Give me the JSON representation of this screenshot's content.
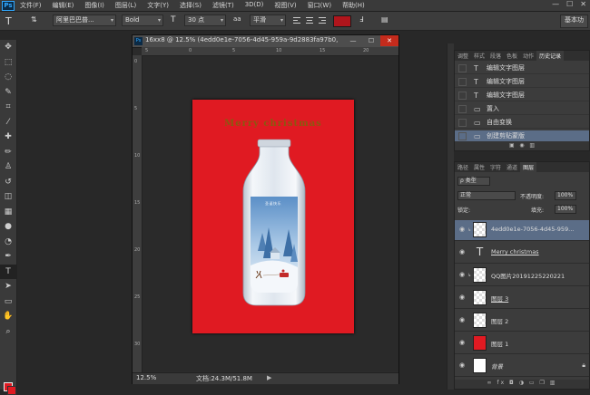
{
  "app": {
    "logo": "Ps"
  },
  "menu": [
    "文件(F)",
    "编辑(E)",
    "图像(I)",
    "图层(L)",
    "文字(Y)",
    "选择(S)",
    "滤镜(T)",
    "3D(D)",
    "视图(V)",
    "窗口(W)",
    "帮助(H)"
  ],
  "window_controls": {
    "minimize": "—",
    "maximize": "☐",
    "close": "✕"
  },
  "options": {
    "tool_icon": "T",
    "font_family": "阿里巴巴普...",
    "font_style": "Bold",
    "size_icon": "T",
    "font_size": "30 点",
    "aa_icon": "aa",
    "antialias": "平滑",
    "text_color": "#b0151c",
    "workspace": "基本功"
  },
  "document": {
    "title": "16xx8 @ 12.5% (4edd0e1e-7056-4d45-959a-9d2883fa97b0, R...",
    "zoom": "12.5%",
    "info": "文档:24.3M/51.8M",
    "artboard_text": "Merry christmas",
    "bottle_label": "圣诞快乐",
    "ruler_top": [
      "5",
      "0",
      "5",
      "10",
      "15",
      "20"
    ],
    "ruler_left": [
      "0",
      "5",
      "10",
      "15",
      "20",
      "25",
      "30"
    ],
    "artboard_color": "#e01a22"
  },
  "history": {
    "tabs": [
      "调整",
      "样式",
      "段落",
      "色板",
      "动作",
      "历史记录"
    ],
    "active_tab": 5,
    "rows": [
      {
        "icon": "T",
        "label": "编辑文字图层"
      },
      {
        "icon": "T",
        "label": "编辑文字图层"
      },
      {
        "icon": "T",
        "label": "编辑文字图层"
      },
      {
        "icon": "▭",
        "label": "置入"
      },
      {
        "icon": "▭",
        "label": "自由变换"
      },
      {
        "icon": "▭",
        "label": "创建剪贴蒙版"
      }
    ],
    "selected_row": 5
  },
  "layers": {
    "tabs": [
      "路径",
      "属性",
      "字符",
      "通道",
      "图层"
    ],
    "active_tab": 4,
    "filter_kind": "ρ 类型",
    "blend_mode": "正常",
    "opacity_label": "不透明度:",
    "opacity": "100%",
    "lock_label": "锁定:",
    "fill_label": "填充:",
    "fill": "100%",
    "items": [
      {
        "name": "4edd0e1e-7056-4d45-959...",
        "thumb": "checker",
        "clip": true,
        "selected": true,
        "style": ""
      },
      {
        "name": "Merry christmas",
        "thumb": "text",
        "clip": false,
        "selected": false,
        "style": "u"
      },
      {
        "name": "QQ图片20191225220221",
        "thumb": "checker",
        "clip": true,
        "selected": false,
        "style": ""
      },
      {
        "name": "图层 3",
        "thumb": "checker",
        "clip": false,
        "selected": false,
        "style": "u"
      },
      {
        "name": "图层 2",
        "thumb": "checker",
        "clip": false,
        "selected": false,
        "style": ""
      },
      {
        "name": "图层 1",
        "thumb": "red",
        "clip": false,
        "selected": false,
        "style": ""
      },
      {
        "name": "背景",
        "thumb": "white",
        "clip": false,
        "selected": false,
        "style": "i",
        "locked": true
      }
    ]
  },
  "colors": {
    "foreground": "#e01a22",
    "background": "#e01a22",
    "selection": "#5b6d87"
  }
}
